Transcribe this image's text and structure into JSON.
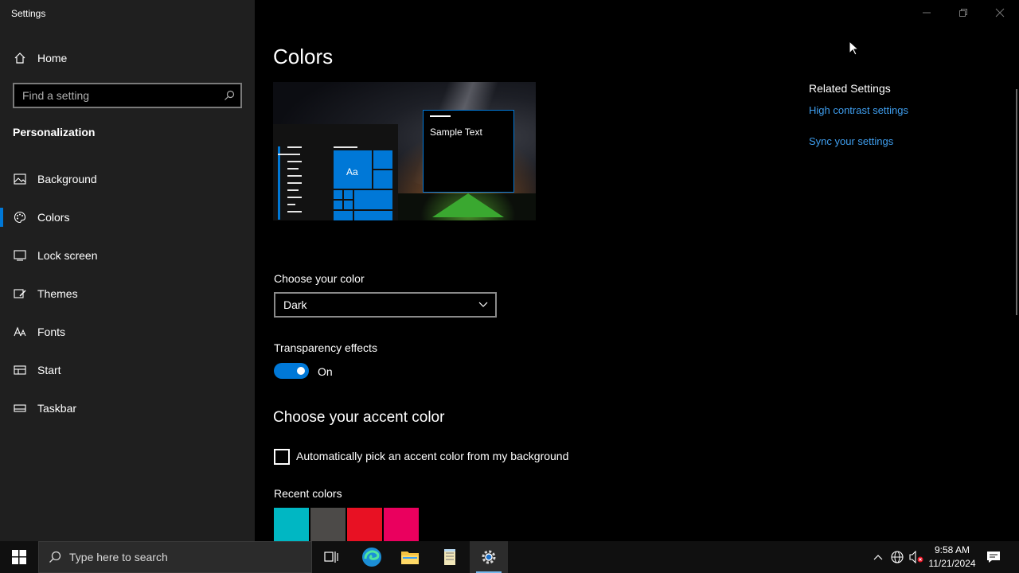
{
  "window": {
    "title": "Settings"
  },
  "sidebar": {
    "home_label": "Home",
    "search_placeholder": "Find a setting",
    "section": "Personalization",
    "items": [
      {
        "label": "Background",
        "icon": "image-icon"
      },
      {
        "label": "Colors",
        "icon": "palette-icon",
        "active": true
      },
      {
        "label": "Lock screen",
        "icon": "lock-screen-icon"
      },
      {
        "label": "Themes",
        "icon": "brush-icon"
      },
      {
        "label": "Fonts",
        "icon": "font-icon"
      },
      {
        "label": "Start",
        "icon": "start-icon"
      },
      {
        "label": "Taskbar",
        "icon": "taskbar-icon"
      }
    ]
  },
  "main": {
    "title": "Colors",
    "preview": {
      "sample_text": "Sample Text",
      "tile_text": "Aa"
    },
    "choose_color_label": "Choose your color",
    "choose_color_value": "Dark",
    "transparency_label": "Transparency effects",
    "transparency_state": "On",
    "accent_heading": "Choose your accent color",
    "auto_accent_label": "Automatically pick an accent color from my background",
    "recent_colors_label": "Recent colors",
    "recent_colors": [
      "#00b7c3",
      "#4c4a48",
      "#e81123",
      "#ea005e"
    ]
  },
  "related": {
    "heading": "Related Settings",
    "links": [
      "High contrast settings",
      "Sync your settings"
    ]
  },
  "taskbar": {
    "search_placeholder": "Type here to search",
    "time": "9:58 AM",
    "date": "11/21/2024"
  },
  "colors": {
    "accent": "#0078d7",
    "link": "#3f9ff0",
    "sidebar_bg": "#1f1f1f"
  }
}
